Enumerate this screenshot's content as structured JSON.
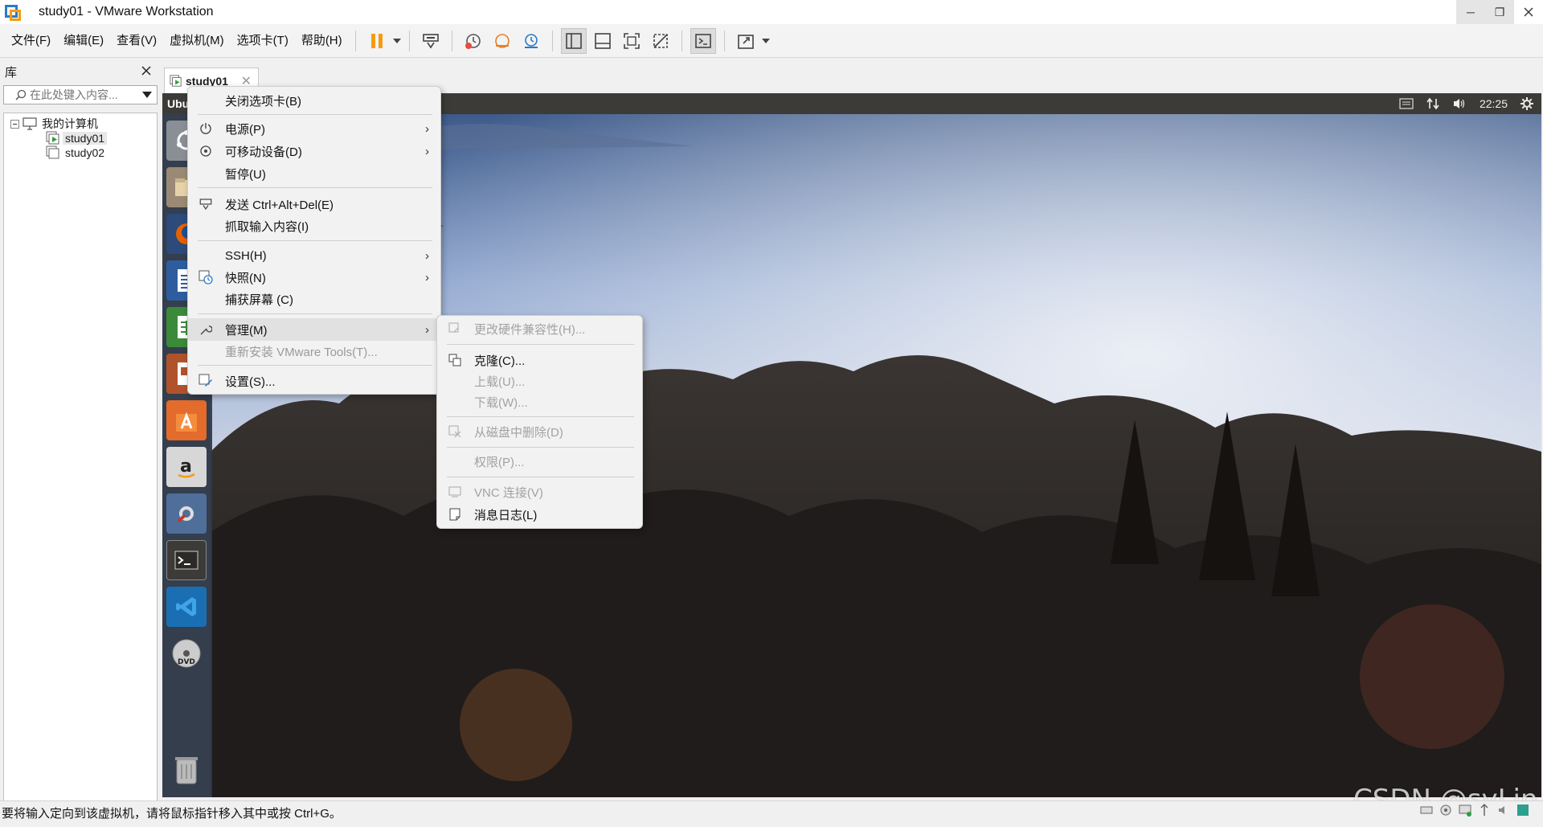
{
  "window": {
    "title": "study01 - VMware Workstation"
  },
  "menubar": {
    "items": [
      "文件(F)",
      "编辑(E)",
      "查看(V)",
      "虚拟机(M)",
      "选项卡(T)",
      "帮助(H)"
    ]
  },
  "library": {
    "title": "库",
    "search_placeholder": "在此处键入内容...",
    "tree": {
      "root": "我的计算机",
      "vms": [
        "study01",
        "study02"
      ]
    }
  },
  "tab": {
    "label": "study01"
  },
  "guest": {
    "app_name": "Ubu",
    "clock": "22:25"
  },
  "context_menu": {
    "close_tab": "关闭选项卡(B)",
    "power": "电源(P)",
    "removable": "可移动设备(D)",
    "pause": "暂停(U)",
    "send_cad": "发送 Ctrl+Alt+Del(E)",
    "grab_input": "抓取输入内容(I)",
    "ssh": "SSH(H)",
    "snapshot": "快照(N)",
    "capture_screen": "捕获屏幕 (C)",
    "manage": "管理(M)",
    "reinstall_tools": "重新安装 VMware Tools(T)...",
    "settings": "设置(S)..."
  },
  "manage_submenu": {
    "hw_compat": "更改硬件兼容性(H)...",
    "clone": "克隆(C)...",
    "upload": "上载(U)...",
    "download": "下载(W)...",
    "delete_disk": "从磁盘中删除(D)",
    "permissions": "权限(P)...",
    "vnc": "VNC 连接(V)",
    "message_log": "消息日志(L)"
  },
  "statusbar": {
    "message": "要将输入定向到该虚拟机，请将鼠标指针移入其中或按 Ctrl+G。"
  },
  "watermark": "CSDN @syLin",
  "colors": {
    "accent_orange": "#f39c12",
    "accent_blue": "#2a7ac8",
    "guest_topbar": "#3c3b37",
    "launcher": "#303846"
  }
}
